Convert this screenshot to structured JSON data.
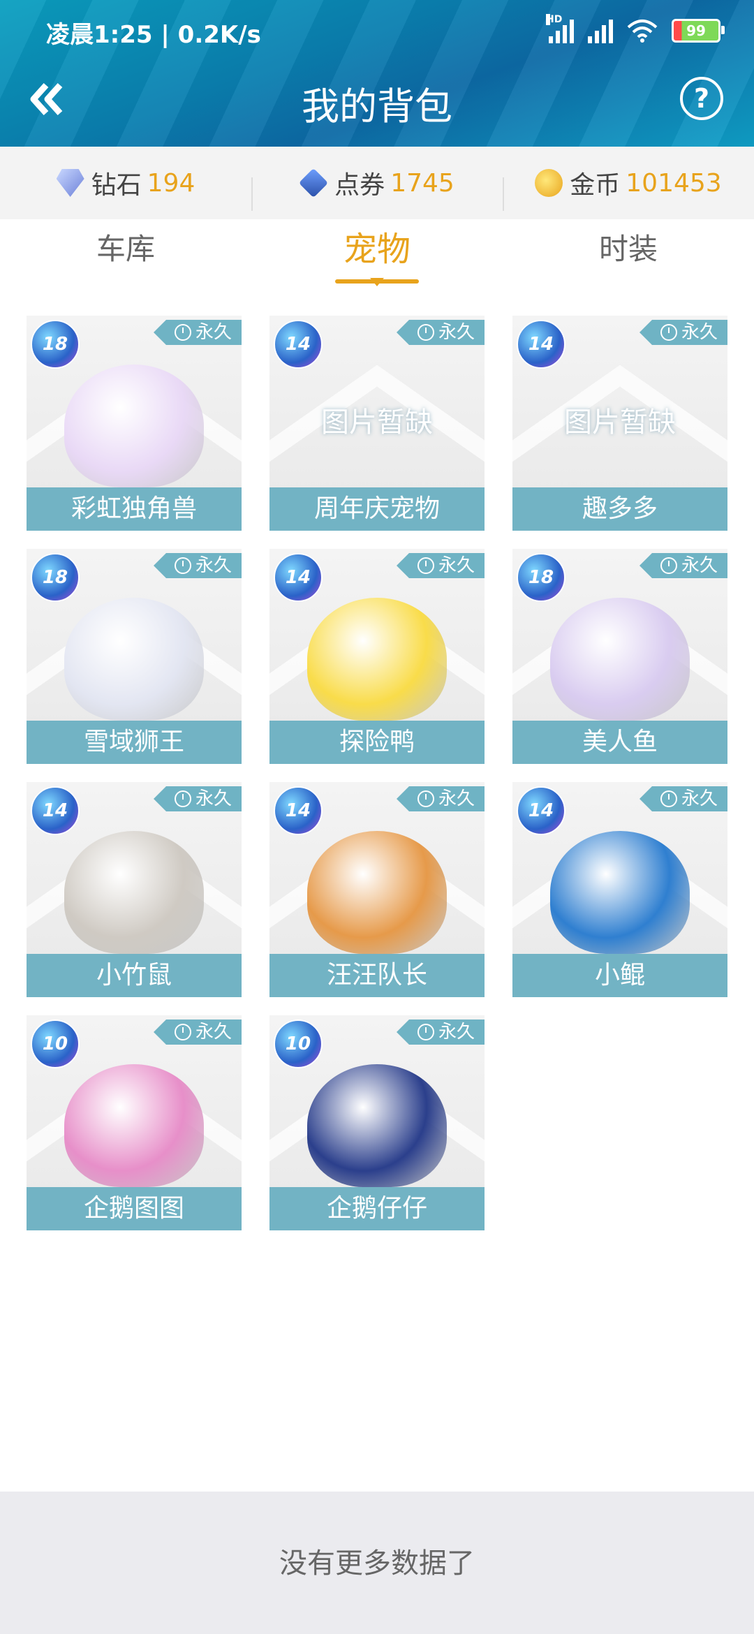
{
  "status_bar": {
    "time_speed": "凌晨1:25 | 0.2K/s",
    "hd": "HD",
    "battery": "99"
  },
  "header": {
    "title": "我的背包",
    "back_icon": "double-chevron-left-icon",
    "help_icon": "question-circle-icon",
    "help_symbol": "?"
  },
  "currencies": [
    {
      "label": "钻石",
      "value": "194",
      "icon": "diamond-icon"
    },
    {
      "label": "点券",
      "value": "1745",
      "icon": "coupon-icon"
    },
    {
      "label": "金币",
      "value": "101453",
      "icon": "coin-icon"
    }
  ],
  "tabs": [
    {
      "label": "车库",
      "active": false
    },
    {
      "label": "宠物",
      "active": true
    },
    {
      "label": "时装",
      "active": false
    }
  ],
  "pets": [
    {
      "name": "彩虹独角兽",
      "level": "18",
      "tag": "永久",
      "color": "#e9d9f6"
    },
    {
      "name": "周年庆宠物",
      "level": "14",
      "tag": "永久",
      "placeholder": "图片暂缺"
    },
    {
      "name": "趣多多",
      "level": "14",
      "tag": "永久",
      "placeholder": "图片暂缺"
    },
    {
      "name": "雪域狮王",
      "level": "18",
      "tag": "永久",
      "color": "#e3e6f2"
    },
    {
      "name": "探险鸭",
      "level": "14",
      "tag": "永久",
      "color": "#f9dc4a"
    },
    {
      "name": "美人鱼",
      "level": "18",
      "tag": "永久",
      "color": "#d9ccf0"
    },
    {
      "name": "小竹鼠",
      "level": "14",
      "tag": "永久",
      "color": "#cfcac3"
    },
    {
      "name": "汪汪队长",
      "level": "14",
      "tag": "永久",
      "color": "#e69a4a"
    },
    {
      "name": "小鲲",
      "level": "14",
      "tag": "永久",
      "color": "#2f7fd0"
    },
    {
      "name": "企鹅图图",
      "level": "10",
      "tag": "永久",
      "color": "#e78fc9"
    },
    {
      "name": "企鹅仔仔",
      "level": "10",
      "tag": "永久",
      "color": "#2b3f8c"
    }
  ],
  "footer": {
    "no_more": "没有更多数据了"
  },
  "accent_color": "#e8a31c"
}
